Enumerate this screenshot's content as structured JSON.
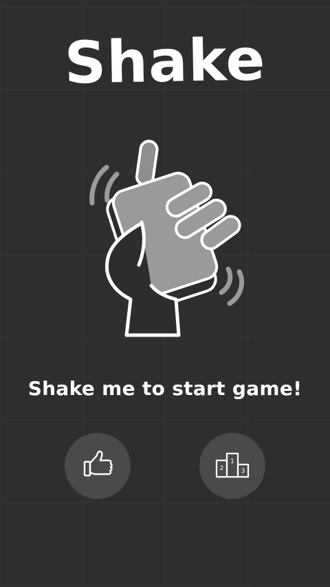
{
  "app": {
    "title": "Shake",
    "prompt": "Shake me to start game!"
  },
  "buttons": {
    "like": {
      "icon": "thumbs-up-icon"
    },
    "leaderboard": {
      "icon": "podium-icon",
      "places": [
        "1",
        "2",
        "3"
      ]
    }
  },
  "colors": {
    "background": "#2d2d2d",
    "button": "#4a4a4a",
    "icon": "#b0b0b0",
    "text": "#ffffff"
  }
}
